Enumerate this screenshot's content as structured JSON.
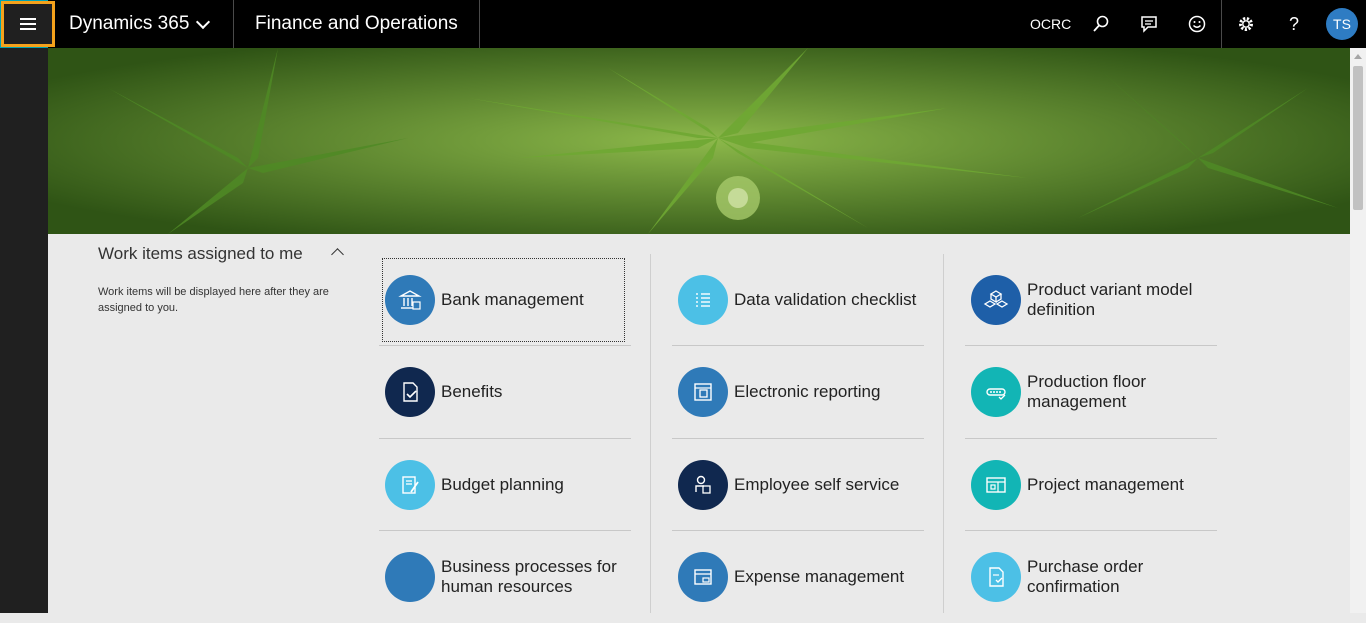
{
  "topbar": {
    "brand": "Dynamics 365",
    "app_name": "Finance and Operations",
    "company": "OCRC",
    "icons": [
      "search-icon",
      "message-icon",
      "smiley-feedback-icon",
      "gear-icon",
      "help-icon"
    ],
    "user_initials": "TS",
    "accent_color": "#00a3b4"
  },
  "navpane": {
    "hamburger_icon": "menu-icon",
    "focus_color": "#f4a21c"
  },
  "hero": {
    "image": "cannabis-plant-photo"
  },
  "work_items": {
    "title": "Work items assigned to me",
    "message": "Work items will be displayed here after they are assigned to you."
  },
  "tiles": {
    "col1": [
      {
        "label": "Bank management",
        "icon": "bank-icon",
        "color": "#2f7ab8"
      },
      {
        "label": "Benefits",
        "icon": "benefits-check-icon",
        "color": "#10284f"
      },
      {
        "label": "Budget planning",
        "icon": "budget-planning-icon",
        "color": "#4cc0e6"
      },
      {
        "label": "Business processes for human resources",
        "icon": "business-process-icon",
        "color": "#2f7ab8"
      }
    ],
    "col2": [
      {
        "label": "Data validation checklist",
        "icon": "checklist-icon",
        "color": "#4cc0e6"
      },
      {
        "label": "Electronic reporting",
        "icon": "electronic-reporting-icon",
        "color": "#2f7ab8"
      },
      {
        "label": "Employee self service",
        "icon": "employee-icon",
        "color": "#10284f"
      },
      {
        "label": "Expense management",
        "icon": "expense-icon",
        "color": "#2f7ab8"
      }
    ],
    "col3": [
      {
        "label": "Product variant model definition",
        "icon": "product-variant-icon",
        "color": "#1e5fa8"
      },
      {
        "label": "Production floor management",
        "icon": "production-floor-icon",
        "color": "#12b5b5"
      },
      {
        "label": "Project management",
        "icon": "project-management-icon",
        "color": "#12b5b5"
      },
      {
        "label": "Purchase order confirmation",
        "icon": "purchase-order-icon",
        "color": "#4cc0e6"
      }
    ]
  }
}
